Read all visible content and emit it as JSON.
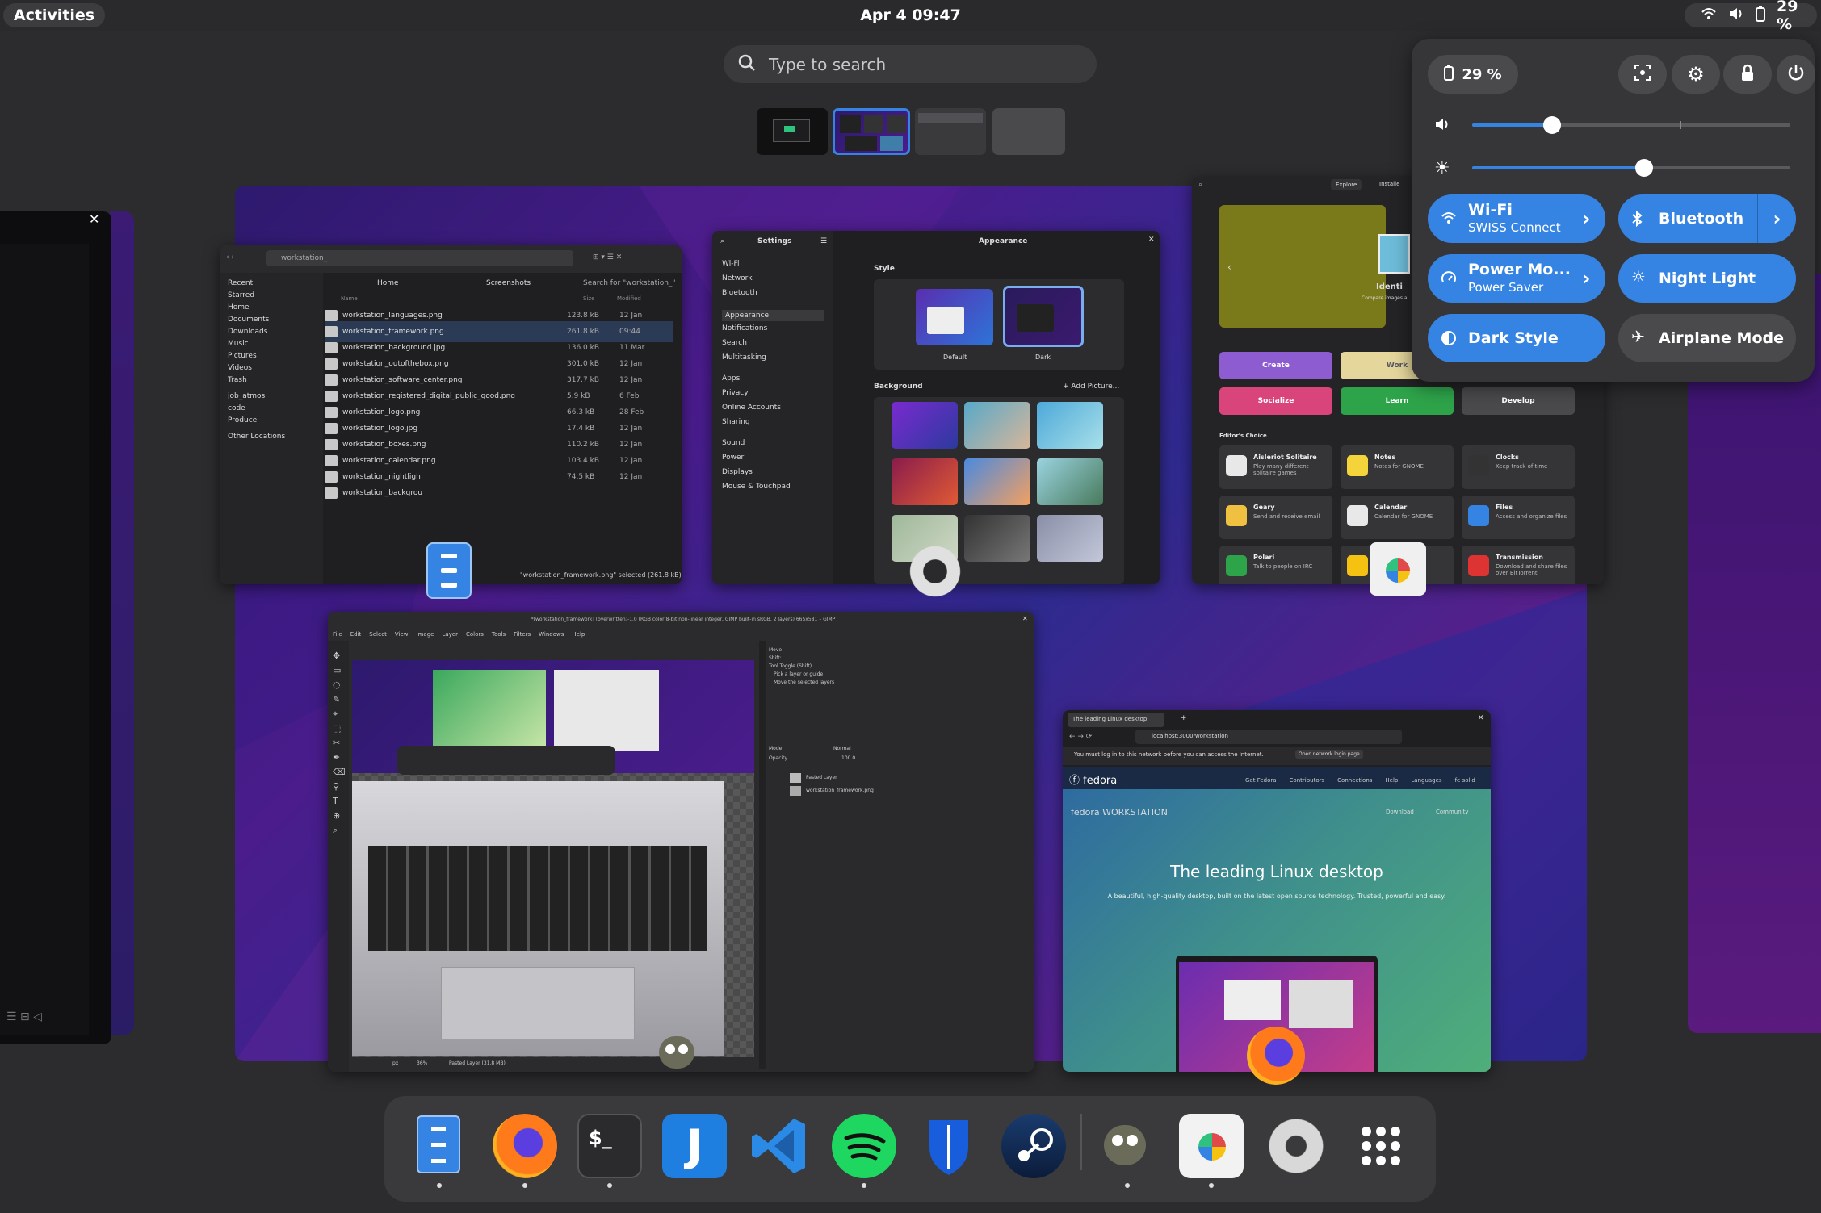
{
  "topbar": {
    "activities_label": "Activities",
    "clock": "Apr 4  09:47",
    "battery_label": "29 %"
  },
  "search": {
    "placeholder": "Type to search"
  },
  "workspaces": [
    "workspace-1",
    "workspace-2",
    "workspace-3",
    "workspace-4"
  ],
  "quick_settings": {
    "battery": "29 %",
    "volume_level": 0.25,
    "brightness_level": 0.54,
    "toggles": {
      "wifi": {
        "label": "Wi-Fi",
        "sub": "SWISS Connect"
      },
      "bluetooth": {
        "label": "Bluetooth"
      },
      "power": {
        "label": "Power Mo...",
        "sub": "Power Saver"
      },
      "night": {
        "label": "Night Light"
      },
      "dark": {
        "label": "Dark Style"
      },
      "airplane": {
        "label": "Airplane Mode"
      }
    }
  },
  "files_window": {
    "search": "workstation_",
    "tabs": [
      "Home",
      "Screenshots",
      "Search for \"workstation_\""
    ],
    "col_name": "Name",
    "col_size": "Size",
    "col_modified": "Modified",
    "sidebar": [
      "Recent",
      "Starred",
      "Home",
      "Documents",
      "Downloads",
      "Music",
      "Pictures",
      "Videos",
      "Trash",
      "job_atmos",
      "code",
      "Produce",
      "Other Locations"
    ],
    "rows": [
      {
        "name": "workstation_languages.png",
        "size": "123.8 kB",
        "date": "12 Jan"
      },
      {
        "name": "workstation_framework.png",
        "size": "261.8 kB",
        "date": "09:44"
      },
      {
        "name": "workstation_background.jpg",
        "size": "136.0 kB",
        "date": "11 Mar"
      },
      {
        "name": "workstation_outofthebox.png",
        "size": "301.0 kB",
        "date": "12 Jan"
      },
      {
        "name": "workstation_software_center.png",
        "size": "317.7 kB",
        "date": "12 Jan"
      },
      {
        "name": "workstation_registered_digital_public_good.png",
        "size": "5.9 kB",
        "date": "6 Feb"
      },
      {
        "name": "workstation_logo.png",
        "size": "66.3 kB",
        "date": "28 Feb"
      },
      {
        "name": "workstation_logo.jpg",
        "size": "17.4 kB",
        "date": "12 Jan"
      },
      {
        "name": "workstation_boxes.png",
        "size": "110.2 kB",
        "date": "12 Jan"
      },
      {
        "name": "workstation_calendar.png",
        "size": "103.4 kB",
        "date": "12 Jan"
      },
      {
        "name": "workstation_nightligh",
        "size": "74.5 kB",
        "date": "12 Jan"
      },
      {
        "name": "workstation_backgrou",
        "size": "",
        "date": ""
      }
    ],
    "status": "\"workstation_framework.png\" selected (261.8 kB)"
  },
  "settings_window": {
    "sidebar_title": "Settings",
    "title": "Appearance",
    "items": [
      "Wi-Fi",
      "Network",
      "Bluetooth",
      "Appearance",
      "Notifications",
      "Search",
      "Multitasking",
      "Apps",
      "Privacy",
      "Online Accounts",
      "Sharing",
      "Sound",
      "Power",
      "Displays",
      "Mouse & Touchpad"
    ],
    "style_label": "Style",
    "default_label": "Default",
    "dark_label": "Dark",
    "background_label": "Background",
    "add_picture": "+ Add Picture..."
  },
  "software_window": {
    "explore": "Explore",
    "installed": "Installe",
    "banner_title": "Identi",
    "banner_sub": "Compare images a",
    "categories": [
      "Create",
      "Work",
      "Socialize",
      "Learn",
      "Develop"
    ],
    "editors_choice": "Editor's Choice",
    "apps": [
      {
        "name": "Aisleriot Solitaire",
        "desc": "Play many different solitaire games"
      },
      {
        "name": "Notes",
        "desc": "Notes for GNOME"
      },
      {
        "name": "Clocks",
        "desc": "Keep track of time"
      },
      {
        "name": "Geary",
        "desc": "Send and receive email"
      },
      {
        "name": "Calendar",
        "desc": "Calendar for GNOME"
      },
      {
        "name": "Files",
        "desc": "Access and organize files"
      },
      {
        "name": "Polari",
        "desc": "Talk to people on IRC"
      },
      {
        "name": "",
        "desc": "ME"
      },
      {
        "name": "Transmission",
        "desc": "Download and share files over BitTorrent"
      }
    ]
  },
  "gimp_window": {
    "title": "*[workstation_framework] (overwritten)-1.0 (RGB color 8-bit non-linear integer, GIMP built-in sRGB, 2 layers) 665x581 – GIMP",
    "menu": [
      "File",
      "Edit",
      "Select",
      "View",
      "Image",
      "Layer",
      "Colors",
      "Tools",
      "Filters",
      "Windows",
      "Help"
    ],
    "layers": [
      "Pasted Layer",
      "workstation_framework.png"
    ],
    "mode": "Mode",
    "mode_val": "Normal",
    "opacity": "Opacity",
    "opacity_val": "100.0",
    "tool_options": [
      "Move",
      "Shift:",
      "Tool Toggle (Shift)",
      "Pick a layer or guide",
      "Move the selected layers"
    ],
    "status": "Pasted Layer (31.8 MB)",
    "zoom": "36%",
    "unit": "px"
  },
  "firefox_window": {
    "tab": "The leading Linux desktop",
    "url": "localhost:3000/workstation",
    "notice": "You must log in to this network before you can access the Internet.",
    "notice_btn": "Open network login page",
    "brand": "fedora",
    "nav": [
      "Get Fedora",
      "Contributors",
      "Connections",
      "Help",
      "Languages",
      "fe solid"
    ],
    "hero_brand": "fedora WORKSTATION",
    "hero_links": [
      "Download",
      "Community"
    ],
    "hero_title": "The leading Linux desktop",
    "hero_sub": "A beautiful, high-quality desktop, built on the latest open source technology. Trusted, powerful and easy."
  },
  "dock": {
    "apps": [
      "files",
      "firefox",
      "terminal",
      "joplin",
      "vscode",
      "spotify",
      "bitwarden",
      "steam",
      "gimp",
      "software",
      "settings",
      "app-grid"
    ]
  },
  "colors": {
    "accent": "#3584e4",
    "panel": "#363638",
    "dock": "#3a3a3c"
  }
}
